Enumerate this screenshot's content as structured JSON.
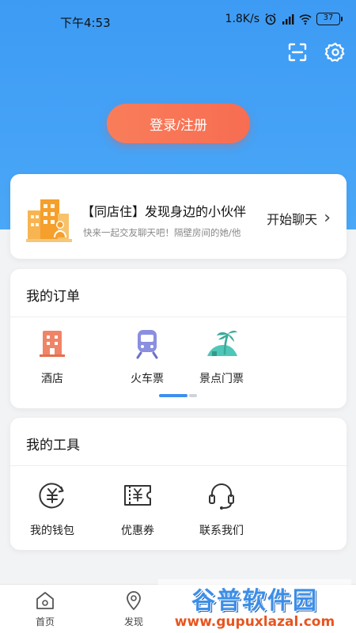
{
  "status_bar": {
    "time": "下午4:53",
    "net_speed": "1.8K/s",
    "battery": "37"
  },
  "header": {
    "login_label": "登录/注册",
    "icons": [
      "scan-icon",
      "settings-icon"
    ]
  },
  "promo": {
    "title": "【同店住】发现身边的小伙伴",
    "subtitle": "快来一起交友聊天吧！隔壁房间的她/他",
    "action": "开始聊天",
    "action_arrow": "›"
  },
  "orders": {
    "title": "我的订单",
    "items": [
      {
        "label": "酒店",
        "icon": "hotel-icon"
      },
      {
        "label": "火车票",
        "icon": "train-icon"
      },
      {
        "label": "景点门票",
        "icon": "scenic-ticket-icon"
      }
    ]
  },
  "tools": {
    "title": "我的工具",
    "items": [
      {
        "label": "我的钱包",
        "icon": "wallet-icon"
      },
      {
        "label": "优惠券",
        "icon": "coupon-icon"
      },
      {
        "label": "联系我们",
        "icon": "headset-icon"
      }
    ]
  },
  "tab_bar": {
    "items": [
      {
        "label": "首页",
        "icon": "home-icon"
      },
      {
        "label": "发现",
        "icon": "location-pin-icon"
      }
    ]
  },
  "watermark": {
    "title": "谷普软件园",
    "url": "www.gupuxlazal.com"
  },
  "colors": {
    "hero_blue": "#3d9bf4",
    "login_orange": "#f76d52",
    "pager_active": "#3d8ff0"
  }
}
